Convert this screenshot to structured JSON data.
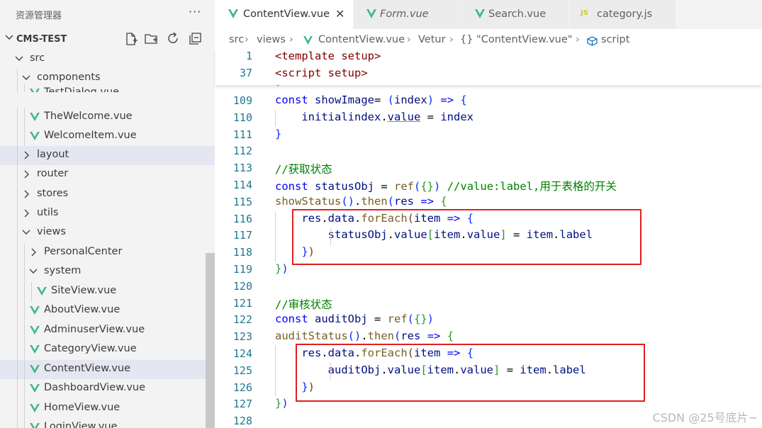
{
  "sidebar": {
    "title": "资源管理器",
    "more": "···",
    "project": "CMS-TEST",
    "tree": [
      {
        "label": "src",
        "kind": "folder",
        "open": true
      },
      {
        "label": "components",
        "kind": "folder",
        "open": true
      },
      {
        "label": "TestDialog.vue",
        "kind": "vue"
      },
      {
        "label": "TheWelcome.vue",
        "kind": "vue"
      },
      {
        "label": "WelcomeItem.vue",
        "kind": "vue"
      },
      {
        "label": "layout",
        "kind": "folder",
        "open": false
      },
      {
        "label": "router",
        "kind": "folder",
        "open": false
      },
      {
        "label": "stores",
        "kind": "folder",
        "open": false
      },
      {
        "label": "utils",
        "kind": "folder",
        "open": false
      },
      {
        "label": "views",
        "kind": "folder",
        "open": true
      },
      {
        "label": "PersonalCenter",
        "kind": "folder",
        "open": false
      },
      {
        "label": "system",
        "kind": "folder",
        "open": true
      },
      {
        "label": "SiteView.vue",
        "kind": "vue"
      },
      {
        "label": "AboutView.vue",
        "kind": "vue"
      },
      {
        "label": "AdminuserView.vue",
        "kind": "vue"
      },
      {
        "label": "CategoryView.vue",
        "kind": "vue"
      },
      {
        "label": "ContentView.vue",
        "kind": "vue"
      },
      {
        "label": "DashboardView.vue",
        "kind": "vue"
      },
      {
        "label": "HomeView.vue",
        "kind": "vue"
      },
      {
        "label": "LoginView.vue",
        "kind": "vue"
      }
    ]
  },
  "tabs": [
    {
      "label": "ContentView.vue",
      "icon": "vue-icon",
      "active": true,
      "close": "✕"
    },
    {
      "label": "Form.vue",
      "icon": "vue-icon",
      "active": false
    },
    {
      "label": "Search.vue",
      "icon": "vue-icon",
      "active": false
    },
    {
      "label": "category.js",
      "icon": "js-icon",
      "icon_text": "JS",
      "active": false
    }
  ],
  "breadcrumb": {
    "src": "src",
    "views": "views",
    "file": "ContentView.vue",
    "vetur": "Vetur",
    "symbol": "{} \"ContentView.vue\"",
    "script": "script"
  },
  "sticky": {
    "lines": [
      "1",
      "37"
    ],
    "template": "<template setup>",
    "script": "<script setup>"
  },
  "code": {
    "line_numbers": [
      "109",
      "110",
      "111",
      "112",
      "113",
      "114",
      "115",
      "116",
      "117",
      "118",
      "119",
      "120",
      "121",
      "122",
      "123",
      "124",
      "125",
      "126",
      "127",
      "128"
    ],
    "lines": [
      {
        "t": [
          [
            "kw",
            "const "
          ],
          [
            "pm",
            "showImage"
          ],
          [
            "",
            "= "
          ],
          [
            "br1",
            "("
          ],
          [
            "pm",
            "index"
          ],
          [
            "br1",
            ")"
          ],
          [
            "",
            " "
          ],
          [
            "kw",
            "=>"
          ],
          [
            "",
            " "
          ],
          [
            "br1",
            "{"
          ]
        ]
      },
      {
        "t": [
          [
            "",
            "    "
          ],
          [
            "pm",
            "initialindex"
          ],
          [
            "",
            "."
          ],
          [
            "pm",
            "value"
          ],
          [
            "",
            " = "
          ],
          [
            "pm",
            "index"
          ]
        ]
      },
      {
        "t": [
          [
            "br1",
            "}"
          ]
        ]
      },
      {
        "t": [
          [
            "",
            ""
          ]
        ]
      },
      {
        "t": [
          [
            "cm",
            "//获取状态"
          ]
        ]
      },
      {
        "t": [
          [
            "kw",
            "const "
          ],
          [
            "pm",
            "statusObj"
          ],
          [
            "",
            " = "
          ],
          [
            "fn",
            "ref"
          ],
          [
            "br1",
            "("
          ],
          [
            "br2",
            "{}"
          ],
          [
            "br1",
            ")"
          ],
          [
            "",
            " "
          ],
          [
            "cm",
            "//value:label,用于表格的开关"
          ]
        ]
      },
      {
        "t": [
          [
            "fn",
            "showStatus"
          ],
          [
            "br1",
            "()"
          ],
          [
            "",
            "."
          ],
          [
            "fn",
            "then"
          ],
          [
            "br1",
            "("
          ],
          [
            "pm",
            "res"
          ],
          [
            "",
            " "
          ],
          [
            "kw",
            "=>"
          ],
          [
            "",
            " "
          ],
          [
            "br2",
            "{"
          ]
        ]
      },
      {
        "t": [
          [
            "",
            "    "
          ],
          [
            "pm",
            "res"
          ],
          [
            "",
            "."
          ],
          [
            "pm",
            "data"
          ],
          [
            "",
            "."
          ],
          [
            "fn",
            "forEach"
          ],
          [
            "br3",
            "("
          ],
          [
            "pm",
            "item"
          ],
          [
            "",
            " "
          ],
          [
            "kw",
            "=>"
          ],
          [
            "",
            " "
          ],
          [
            "br1",
            "{"
          ]
        ]
      },
      {
        "t": [
          [
            "",
            "        "
          ],
          [
            "pm",
            "statusObj"
          ],
          [
            "",
            "."
          ],
          [
            "pm",
            "value"
          ],
          [
            "br2",
            "["
          ],
          [
            "pm",
            "item"
          ],
          [
            "",
            "."
          ],
          [
            "pm",
            "value"
          ],
          [
            "br2",
            "]"
          ],
          [
            "",
            " = "
          ],
          [
            "pm",
            "item"
          ],
          [
            "",
            "."
          ],
          [
            "pm",
            "label"
          ]
        ]
      },
      {
        "t": [
          [
            "",
            "    "
          ],
          [
            "br1",
            "}"
          ],
          [
            "br3",
            ")"
          ]
        ]
      },
      {
        "t": [
          [
            "br2",
            "}"
          ],
          [
            "br1",
            ")"
          ]
        ]
      },
      {
        "t": [
          [
            "",
            ""
          ]
        ]
      },
      {
        "t": [
          [
            "cm",
            "//审核状态"
          ]
        ]
      },
      {
        "t": [
          [
            "kw",
            "const "
          ],
          [
            "pm",
            "auditObj"
          ],
          [
            "",
            " = "
          ],
          [
            "fn",
            "ref"
          ],
          [
            "br1",
            "("
          ],
          [
            "br2",
            "{}"
          ],
          [
            "br1",
            ")"
          ]
        ]
      },
      {
        "t": [
          [
            "fn",
            "auditStatus"
          ],
          [
            "br1",
            "()"
          ],
          [
            "",
            "."
          ],
          [
            "fn",
            "then"
          ],
          [
            "br1",
            "("
          ],
          [
            "pm",
            "res"
          ],
          [
            "",
            " "
          ],
          [
            "kw",
            "=>"
          ],
          [
            "",
            " "
          ],
          [
            "br2",
            "{"
          ]
        ]
      },
      {
        "t": [
          [
            "",
            "    "
          ],
          [
            "pm",
            "res"
          ],
          [
            "",
            "."
          ],
          [
            "pm",
            "data"
          ],
          [
            "",
            "."
          ],
          [
            "fn",
            "forEach"
          ],
          [
            "br3",
            "("
          ],
          [
            "pm",
            "item"
          ],
          [
            "",
            " "
          ],
          [
            "kw",
            "=>"
          ],
          [
            "",
            " "
          ],
          [
            "br1",
            "{"
          ]
        ]
      },
      {
        "t": [
          [
            "",
            "        "
          ],
          [
            "pm",
            "auditObj"
          ],
          [
            "",
            "."
          ],
          [
            "pm",
            "value"
          ],
          [
            "br2",
            "["
          ],
          [
            "pm",
            "item"
          ],
          [
            "",
            "."
          ],
          [
            "pm",
            "value"
          ],
          [
            "br2",
            "]"
          ],
          [
            "",
            " = "
          ],
          [
            "pm",
            "item"
          ],
          [
            "",
            "."
          ],
          [
            "pm",
            "label"
          ]
        ]
      },
      {
        "t": [
          [
            "",
            "    "
          ],
          [
            "br1",
            "}"
          ],
          [
            "br3",
            ")"
          ]
        ]
      },
      {
        "t": [
          [
            "br2",
            "}"
          ],
          [
            "br1",
            ")"
          ]
        ]
      },
      {
        "t": [
          [
            "",
            ""
          ]
        ]
      }
    ]
  },
  "watermark": "CSDN @25号底片~",
  "colors": {
    "vue_green": "#41b883",
    "js_yellow": "#cbcb41",
    "highlight_red": "#e02020"
  }
}
